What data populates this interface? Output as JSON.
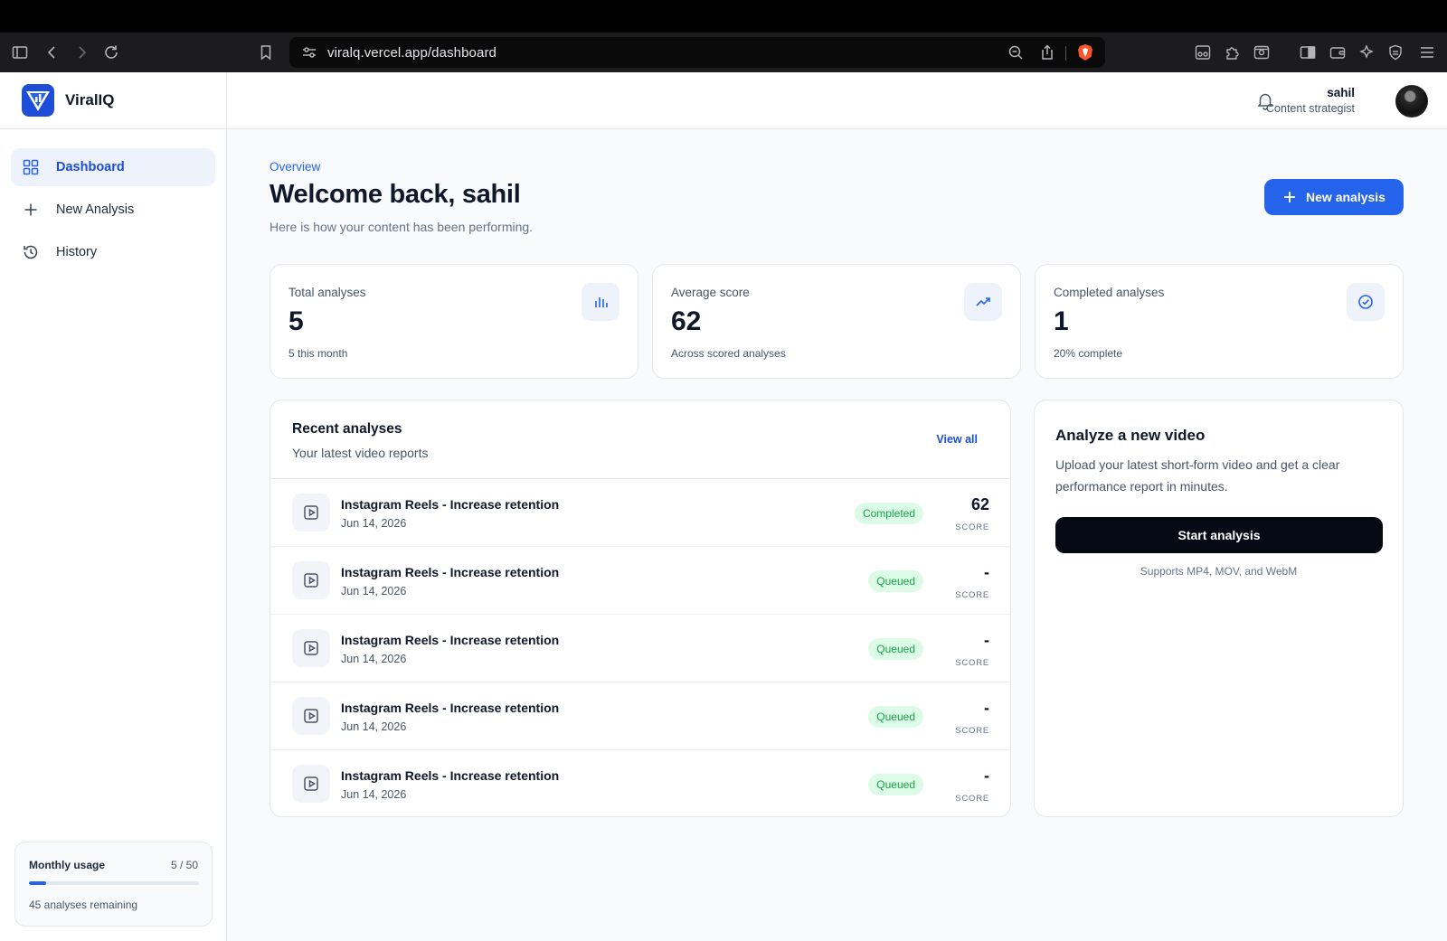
{
  "browser": {
    "url": "viralq.vercel.app/dashboard"
  },
  "app": {
    "name": "ViralIQ"
  },
  "sidebar": {
    "items": [
      {
        "label": "Dashboard",
        "icon": "grid-icon",
        "active": true
      },
      {
        "label": "New Analysis",
        "icon": "plus-icon",
        "active": false
      },
      {
        "label": "History",
        "icon": "history-icon",
        "active": false
      }
    ],
    "usage": {
      "label": "Monthly usage",
      "count": "5 / 50",
      "progress": 0.1,
      "remaining": "45 analyses remaining"
    }
  },
  "header": {
    "user_name": "sahil",
    "user_role": "Content strategist"
  },
  "main": {
    "eyebrow": "Overview",
    "title": "Welcome back, sahil",
    "subtitle": "Here is how your content has been performing.",
    "new_button": "New analysis",
    "stats": [
      {
        "label": "Total analyses",
        "value": "5",
        "note": "5 this month",
        "icon": "bar-chart-icon"
      },
      {
        "label": "Average score",
        "value": "62",
        "note": "Across scored analyses",
        "icon": "trending-up-icon"
      },
      {
        "label": "Completed analyses",
        "value": "1",
        "note": "20% complete",
        "icon": "check-circle-icon"
      }
    ],
    "recent": {
      "title": "Recent analyses",
      "subtitle": "Your latest video reports",
      "view_all": "View all",
      "score_label": "SCORE",
      "rows": [
        {
          "name": "Instagram Reels - Increase retention",
          "date": "Jun 14, 2026",
          "status": "Completed",
          "score": "62"
        },
        {
          "name": "Instagram Reels - Increase retention",
          "date": "Jun 14, 2026",
          "status": "Queued",
          "score": "-"
        },
        {
          "name": "Instagram Reels - Increase retention",
          "date": "Jun 14, 2026",
          "status": "Queued",
          "score": "-"
        },
        {
          "name": "Instagram Reels - Increase retention",
          "date": "Jun 14, 2026",
          "status": "Queued",
          "score": "-"
        },
        {
          "name": "Instagram Reels - Increase retention",
          "date": "Jun 14, 2026",
          "status": "Queued",
          "score": "-"
        }
      ]
    },
    "analyze": {
      "title": "Analyze a new video",
      "description": "Upload your latest short-form video and get a clear performance report in minutes.",
      "button": "Start analysis",
      "note": "Supports MP4, MOV, and WebM"
    }
  },
  "colors": {
    "accent": "#2563eb",
    "badge_bg": "#dcfce7",
    "badge_text": "#16a34a",
    "dark_button": "#050914"
  }
}
